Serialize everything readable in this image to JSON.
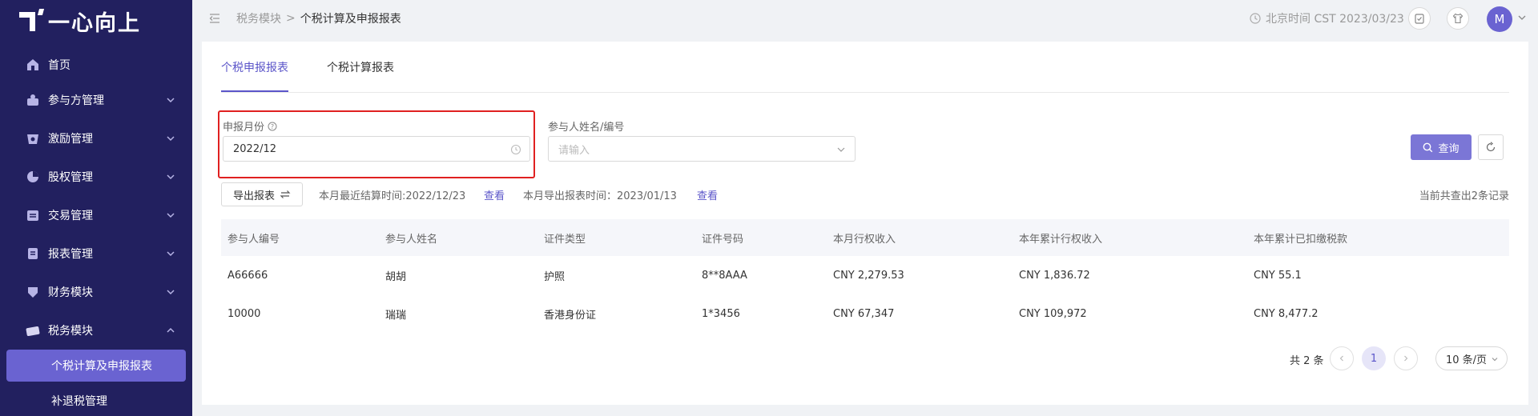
{
  "app": {
    "logo_text": "一心向上"
  },
  "sidebar": {
    "items": [
      {
        "label": "首页",
        "icon": "home-icon"
      },
      {
        "label": "参与方管理",
        "icon": "participant-icon"
      },
      {
        "label": "激励管理",
        "icon": "incentive-icon"
      },
      {
        "label": "股权管理",
        "icon": "equity-icon"
      },
      {
        "label": "交易管理",
        "icon": "trade-icon"
      },
      {
        "label": "报表管理",
        "icon": "report-icon"
      },
      {
        "label": "财务模块",
        "icon": "finance-icon"
      },
      {
        "label": "税务模块",
        "icon": "tax-icon"
      }
    ],
    "sub_items": [
      {
        "label": "个税计算及申报报表",
        "active": true
      },
      {
        "label": "补退税管理",
        "active": false
      }
    ]
  },
  "header": {
    "breadcrumb": [
      "税务模块",
      "个税计算及申报报表"
    ],
    "time_label": "北京时间 CST 2023/03/23",
    "avatar_letter": "M"
  },
  "tabs": [
    {
      "label": "个税申报报表",
      "active": true
    },
    {
      "label": "个税计算报表",
      "active": false
    }
  ],
  "filters": {
    "month": {
      "label": "申报月份",
      "value": "2022/12"
    },
    "participant": {
      "label": "参与人姓名/编号",
      "placeholder": "请输入"
    },
    "query_label": "查询"
  },
  "toolbar": {
    "export_label": "导出报表",
    "settle_text": "本月最近结算时间:2022/12/23",
    "view_label_1": "查看",
    "export_time_text": "本月导出报表时间：2023/01/13",
    "view_label_2": "查看",
    "total_text": "当前共查出2条记录"
  },
  "table": {
    "columns": [
      "参与人编号",
      "参与人姓名",
      "证件类型",
      "证件号码",
      "本月行权收入",
      "本年累计行权收入",
      "本年累计已扣缴税款"
    ],
    "rows": [
      [
        "A66666",
        "胡胡",
        "护照",
        "8**8AAA",
        "CNY 2,279.53",
        "CNY 1,836.72",
        "CNY 55.1"
      ],
      [
        "10000",
        "瑞瑞",
        "香港身份证",
        "1*3456",
        "CNY 67,347",
        "CNY 109,972",
        "CNY 8,477.2"
      ]
    ]
  },
  "pagination": {
    "total_text": "共 2 条",
    "current_page": "1",
    "page_size": "10 条/页"
  },
  "colors": {
    "sidebar_bg": "#22205f",
    "accent": "#5b55c9",
    "active_item": "#6a63d1",
    "highlight": "#e02020"
  }
}
